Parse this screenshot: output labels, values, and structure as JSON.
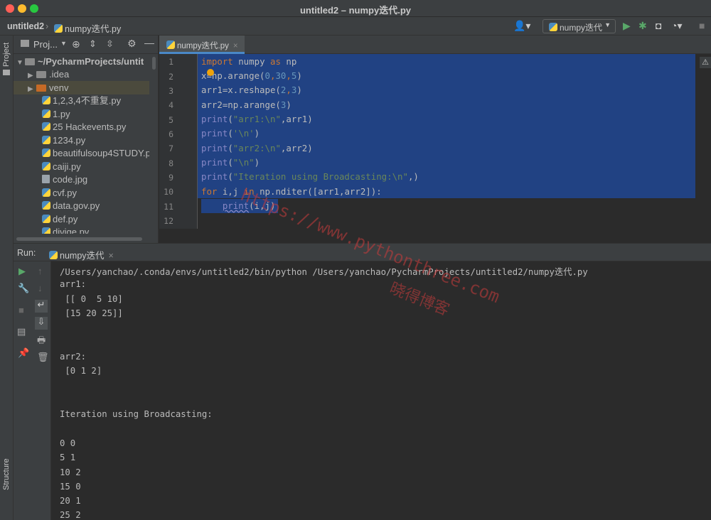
{
  "window": {
    "title": "untitled2 – numpy迭代.py"
  },
  "navbar": {
    "project_crumb": "untitled2",
    "file_crumb": "numpy迭代.py",
    "run_config": "numpy迭代"
  },
  "left_stripe": {
    "project_label": "Project",
    "structure_label": "Structure"
  },
  "project": {
    "header_label": "Proj...",
    "tree": [
      {
        "label": "~/PycharmProjects/untit",
        "kind": "root"
      },
      {
        "label": ".idea",
        "kind": "folder"
      },
      {
        "label": "venv",
        "kind": "folder-selected"
      },
      {
        "label": "1,2,3,4不重复.py",
        "kind": "file"
      },
      {
        "label": "1.py",
        "kind": "file"
      },
      {
        "label": "25 Hackevents.py",
        "kind": "file"
      },
      {
        "label": "1234.py",
        "kind": "file"
      },
      {
        "label": "beautifulsoup4STUDY.p",
        "kind": "file"
      },
      {
        "label": "caiji.py",
        "kind": "file"
      },
      {
        "label": "code.jpg",
        "kind": "file"
      },
      {
        "label": "cvf.py",
        "kind": "file"
      },
      {
        "label": "data.gov.py",
        "kind": "file"
      },
      {
        "label": "def.py",
        "kind": "file"
      },
      {
        "label": "divige.py",
        "kind": "file"
      }
    ]
  },
  "editor": {
    "tab_label": "numpy迭代.py",
    "line_numbers": [
      "1",
      "2",
      "3",
      "4",
      "5",
      "6",
      "7",
      "8",
      "9",
      "10",
      "11",
      "12"
    ],
    "code": {
      "l1_kw_import": "import",
      "l1_mod": " numpy ",
      "l1_kw_as": "as",
      "l1_alias": " np",
      "l2_a": "x=np.arange(",
      "l2_n0": "0",
      "l2_c1": ",",
      "l2_n30": "30",
      "l2_c2": ",",
      "l2_n5": "5",
      "l2_b": ")",
      "l3_a": "arr1=x.reshape(",
      "l3_n2": "2",
      "l3_c": ",",
      "l3_n3": "3",
      "l3_b": ")",
      "l4_a": "arr2=np.arange(",
      "l4_n3": "3",
      "l4_b": ")",
      "l5_fn": "print",
      "l5_p": "(",
      "l5_str": "\"arr1:\\n\"",
      "l5_rest": ",arr1)",
      "l6_fn": "print",
      "l6_p": "(",
      "l6_str": "'\\n'",
      "l6_rest": ")",
      "l7_fn": "print",
      "l7_p": "(",
      "l7_str": "\"arr2:\\n\"",
      "l7_rest": ",arr2)",
      "l8_fn": "print",
      "l8_p": "(",
      "l8_str": "\"\\n\"",
      "l8_rest": ")",
      "l9_fn": "print",
      "l9_p": "(",
      "l9_str": "\"Iteration using Broadcasting:\\n\"",
      "l9_rest": ",)",
      "l10_kw_for": "for",
      "l10_vars": " i,j ",
      "l10_kw_in": "in",
      "l10_rest": " np.nditer([arr1,arr2]):",
      "l11_indent": "    ",
      "l11_fn": "print",
      "l11_rest": "(i,j)"
    }
  },
  "run": {
    "label": "Run:",
    "tab_label": "numpy迭代",
    "output": [
      "/Users/yanchao/.conda/envs/untitled2/bin/python /Users/yanchao/PycharmProjects/untitled2/numpy迭代.py",
      "arr1:",
      " [[ 0  5 10]",
      " [15 20 25]]",
      "",
      "",
      "arr2:",
      " [0 1 2]",
      "",
      "",
      "Iteration using Broadcasting:",
      "",
      "0 0",
      "5 1",
      "10 2",
      "15 0",
      "20 1",
      "25 2"
    ]
  },
  "watermark": {
    "url_text": "https://www.pythonthree.com",
    "brand_text": "晓得博客"
  },
  "colors": {
    "background": "#2b2b2b",
    "panel": "#3c3f41",
    "selection": "#214283",
    "keyword": "#cc7832",
    "string": "#6a8759",
    "number": "#6897bb",
    "builtin": "#8888c6"
  }
}
